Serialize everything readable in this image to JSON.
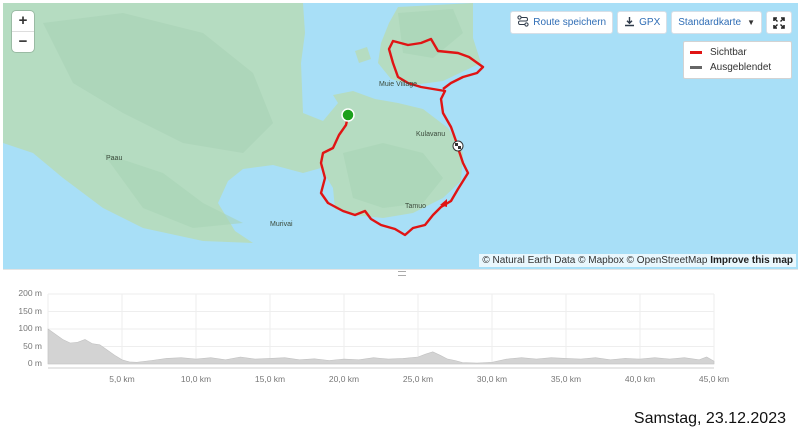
{
  "map": {
    "zoom_in": "+",
    "zoom_out": "−",
    "toolbar": {
      "save_route": "Route speichern",
      "gpx": "GPX",
      "map_style": "Standardkarte"
    },
    "legend": [
      {
        "label": "Sichtbar",
        "color": "#e01414"
      },
      {
        "label": "Ausgeblendet",
        "color": "#666666"
      }
    ],
    "places": [
      "Muie Village",
      "Kulavanu",
      "Paau",
      "Tamuo",
      "Murivai"
    ],
    "attribution": {
      "text": "© Natural Earth Data © Mapbox © OpenStreetMap",
      "link": "Improve this map"
    },
    "colors": {
      "water": "#a8dff7",
      "land": "#b5dcc1",
      "route": "#e01414",
      "start": "#1ca01c"
    }
  },
  "elevation": {
    "y_ticks": [
      "200 m",
      "150 m",
      "100 m",
      "50 m",
      "0 m"
    ],
    "x_ticks": [
      "5,0 km",
      "10,0 km",
      "15,0 km",
      "20,0 km",
      "25,0 km",
      "30,0 km",
      "35,0 km",
      "40,0 km",
      "45,0 km"
    ],
    "chart_data": {
      "type": "area",
      "xlabel": "",
      "ylabel": "",
      "xlim": [
        0,
        45
      ],
      "ylim": [
        0,
        200
      ],
      "x": [
        0,
        0.5,
        1,
        1.5,
        2,
        2.5,
        3,
        3.5,
        4,
        4.5,
        5,
        5.5,
        6,
        7,
        8,
        9,
        10,
        11,
        12,
        13,
        14,
        15,
        16,
        17,
        18,
        19,
        20,
        21,
        22,
        23,
        24,
        25,
        25.5,
        26,
        26.5,
        27,
        27.5,
        28,
        29,
        30,
        31,
        32,
        33,
        34,
        35,
        36,
        37,
        38,
        39,
        40,
        41,
        42,
        43,
        44,
        44.5,
        45
      ],
      "values": [
        100,
        85,
        70,
        60,
        62,
        70,
        58,
        55,
        40,
        25,
        12,
        6,
        5,
        10,
        16,
        18,
        14,
        18,
        12,
        20,
        14,
        16,
        18,
        12,
        15,
        10,
        14,
        12,
        18,
        14,
        16,
        20,
        28,
        35,
        25,
        14,
        10,
        4,
        3,
        5,
        14,
        18,
        14,
        18,
        16,
        14,
        18,
        12,
        16,
        14,
        18,
        14,
        18,
        12,
        20,
        8
      ]
    }
  },
  "date": "Samstag, 23.12.2023"
}
